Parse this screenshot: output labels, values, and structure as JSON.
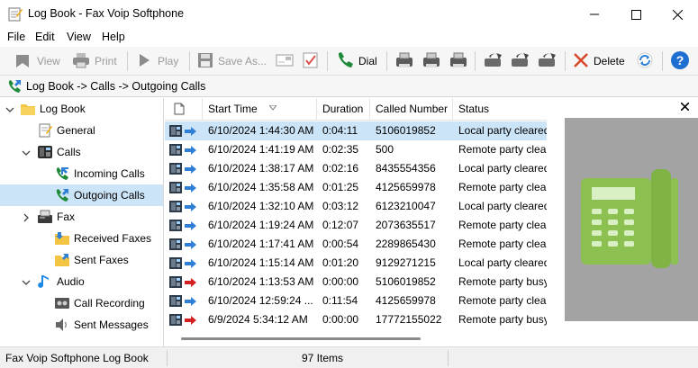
{
  "window": {
    "title": "Log Book - Fax Voip Softphone"
  },
  "menu": [
    "File",
    "Edit",
    "View",
    "Help"
  ],
  "toolbar": {
    "view_label": "View",
    "print_label": "Print",
    "play_label": "Play",
    "save_as_label": "Save As...",
    "dial_label": "Dial",
    "delete_label": "Delete"
  },
  "breadcrumb": "Log Book -> Calls -> Outgoing Calls",
  "tree": {
    "log_book": "Log Book",
    "general": "General",
    "calls": "Calls",
    "incoming_calls": "Incoming Calls",
    "outgoing_calls": "Outgoing Calls",
    "fax": "Fax",
    "received_faxes": "Received Faxes",
    "sent_faxes": "Sent Faxes",
    "audio": "Audio",
    "call_recording": "Call Recording",
    "sent_messages": "Sent Messages"
  },
  "grid": {
    "columns": [
      "Start Time",
      "Duration",
      "Called Number",
      "Status"
    ],
    "rows": [
      {
        "start": "6/10/2024 1:44:30 AM",
        "duration": "0:04:11",
        "number": "5106019852",
        "status": "Local party cleared",
        "arrow": "blue"
      },
      {
        "start": "6/10/2024 1:41:19 AM",
        "duration": "0:02:35",
        "number": "500",
        "status": "Remote party cleared",
        "arrow": "blue"
      },
      {
        "start": "6/10/2024 1:38:17 AM",
        "duration": "0:02:16",
        "number": "8435554356",
        "status": "Local party cleared",
        "arrow": "blue"
      },
      {
        "start": "6/10/2024 1:35:58 AM",
        "duration": "0:01:25",
        "number": "4125659978",
        "status": "Remote party cleared",
        "arrow": "blue"
      },
      {
        "start": "6/10/2024 1:32:10 AM",
        "duration": "0:03:12",
        "number": "6123210047",
        "status": "Local party cleared",
        "arrow": "blue"
      },
      {
        "start": "6/10/2024 1:19:24 AM",
        "duration": "0:12:07",
        "number": "2073635517",
        "status": "Remote party cleared",
        "arrow": "blue"
      },
      {
        "start": "6/10/2024 1:17:41 AM",
        "duration": "0:00:54",
        "number": "2289865430",
        "status": "Remote party cleared",
        "arrow": "blue"
      },
      {
        "start": "6/10/2024 1:15:14 AM",
        "duration": "0:01:20",
        "number": "9129271215",
        "status": "Local party cleared",
        "arrow": "blue"
      },
      {
        "start": "6/10/2024 1:13:53 AM",
        "duration": "0:00:00",
        "number": "5106019852",
        "status": "Remote party busy",
        "arrow": "red"
      },
      {
        "start": "6/10/2024 12:59:24 ...",
        "duration": "0:11:54",
        "number": "4125659978",
        "status": "Remote party cleared",
        "arrow": "blue"
      },
      {
        "start": "6/9/2024 5:34:12 AM",
        "duration": "0:00:00",
        "number": "17772155022",
        "status": "Remote party busy",
        "arrow": "red"
      }
    ]
  },
  "status": {
    "left": "Fax Voip Softphone Log Book",
    "count": "97 Items"
  },
  "colors": {
    "selection": "#cce4f7",
    "arrow_blue": "#2f7fd6",
    "arrow_red": "#d42020",
    "phone_green": "#8cc152"
  }
}
